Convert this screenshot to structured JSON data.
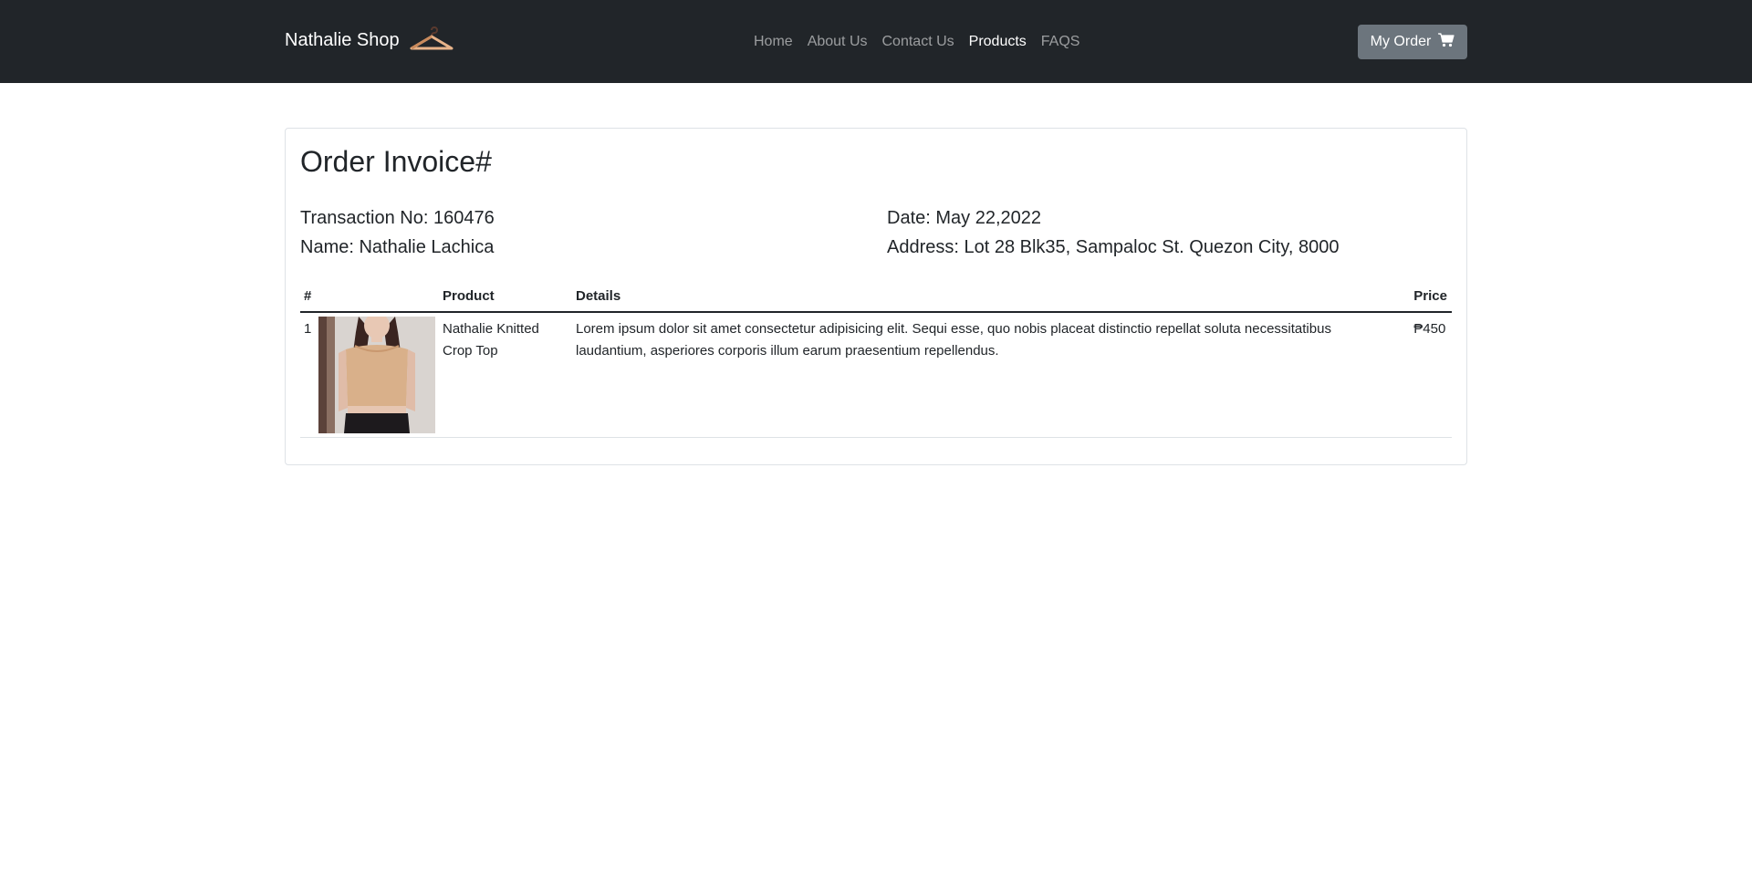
{
  "navbar": {
    "brand": "Nathalie Shop",
    "links": [
      {
        "label": "Home",
        "active": false
      },
      {
        "label": "About Us",
        "active": false
      },
      {
        "label": "Contact Us",
        "active": false
      },
      {
        "label": "Products",
        "active": true
      },
      {
        "label": "FAQS",
        "active": false
      }
    ],
    "order_button": "My Order"
  },
  "invoice": {
    "title": "Order Invoice#",
    "transaction": "Transaction No: 160476",
    "name": "Name: Nathalie Lachica",
    "date": "Date: May 22,2022",
    "address": "Address: Lot 28 Blk35, Sampaloc St. Quezon City, 8000",
    "columns": {
      "num": "#",
      "product": "Product",
      "details": "Details",
      "price": "Price"
    },
    "rows": [
      {
        "num": "1",
        "product": "Nathalie Knitted Crop Top",
        "details": "Lorem ipsum dolor sit amet consectetur adipisicing elit. Sequi esse, quo nobis placeat distinctio repellat soluta necessitatibus laudantium, asperiores corporis illum earum praesentium repellendus.",
        "price": "₱450"
      }
    ]
  },
  "colors": {
    "navbar_bg": "#212529",
    "button_bg": "#6c757d",
    "hanger_accent": "#e8b48a"
  }
}
